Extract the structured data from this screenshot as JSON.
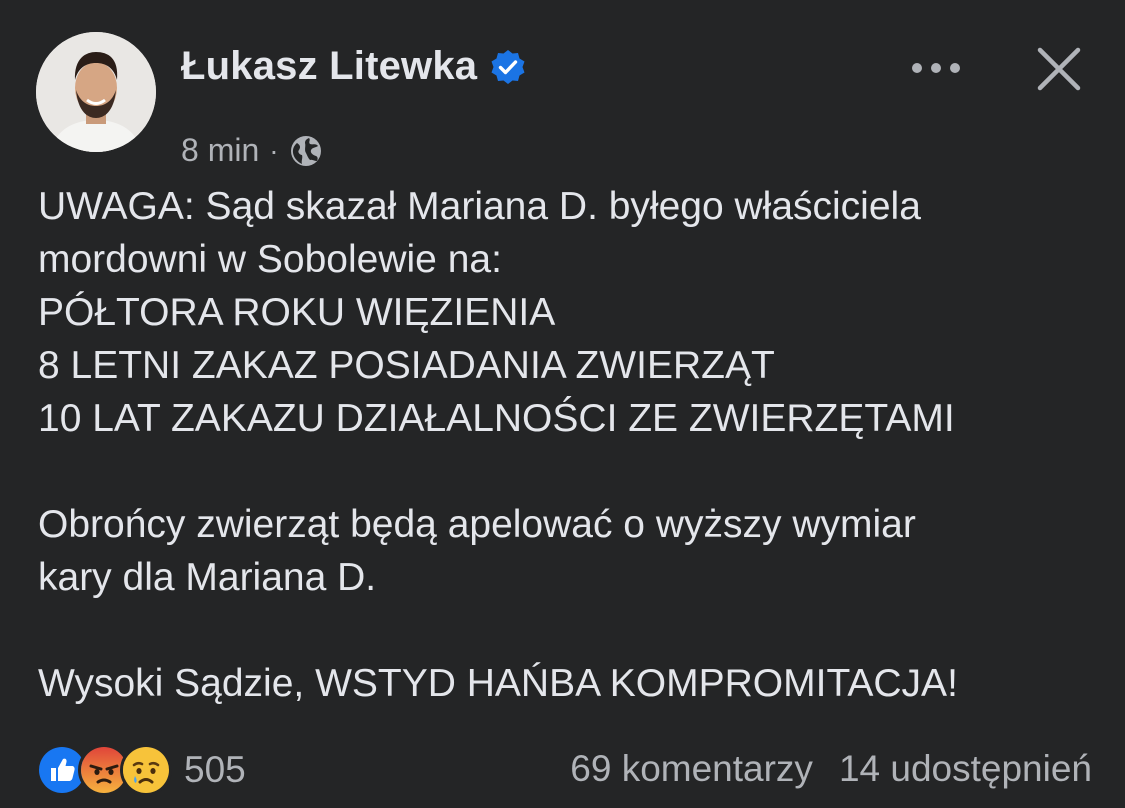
{
  "post": {
    "author_name": "Łukasz Litewka",
    "time": "8 min",
    "separator": "·",
    "paragraphs": [
      "UWAGA: Sąd skazał Mariana D. byłego właściciela\nmordowni w Sobolewie na:\nPÓŁTORA ROKU WIĘZIENIA\n8 LETNI ZAKAZ POSIADANIA ZWIERZĄT\n10 LAT ZAKAZU DZIAŁALNOŚCI ZE ZWIERZĘTAMI",
      "Obrońcy zwierząt będą apelować o wyższy wymiar\nkary dla Mariana D.",
      "Wysoki Sądzie, WSTYD HAŃBA KOMPROMITACJA!"
    ],
    "reactions": {
      "types": [
        "like",
        "angry",
        "sad"
      ],
      "count": "505"
    },
    "comments_label": "69 komentarzy",
    "shares_label": "14 udostępnień"
  },
  "colors": {
    "background": "#242526",
    "text_primary": "#e4e6eb",
    "text_secondary": "#b0b3b8",
    "verified_blue": "#1b74e4",
    "like_blue": "#1877f2",
    "angry_red": "#e9710f",
    "sad_yellow": "#f7b928"
  },
  "icons": [
    "avatar",
    "verified-badge-icon",
    "globe-icon",
    "more-icon",
    "close-icon",
    "like-reaction-icon",
    "angry-reaction-icon",
    "sad-reaction-icon"
  ]
}
